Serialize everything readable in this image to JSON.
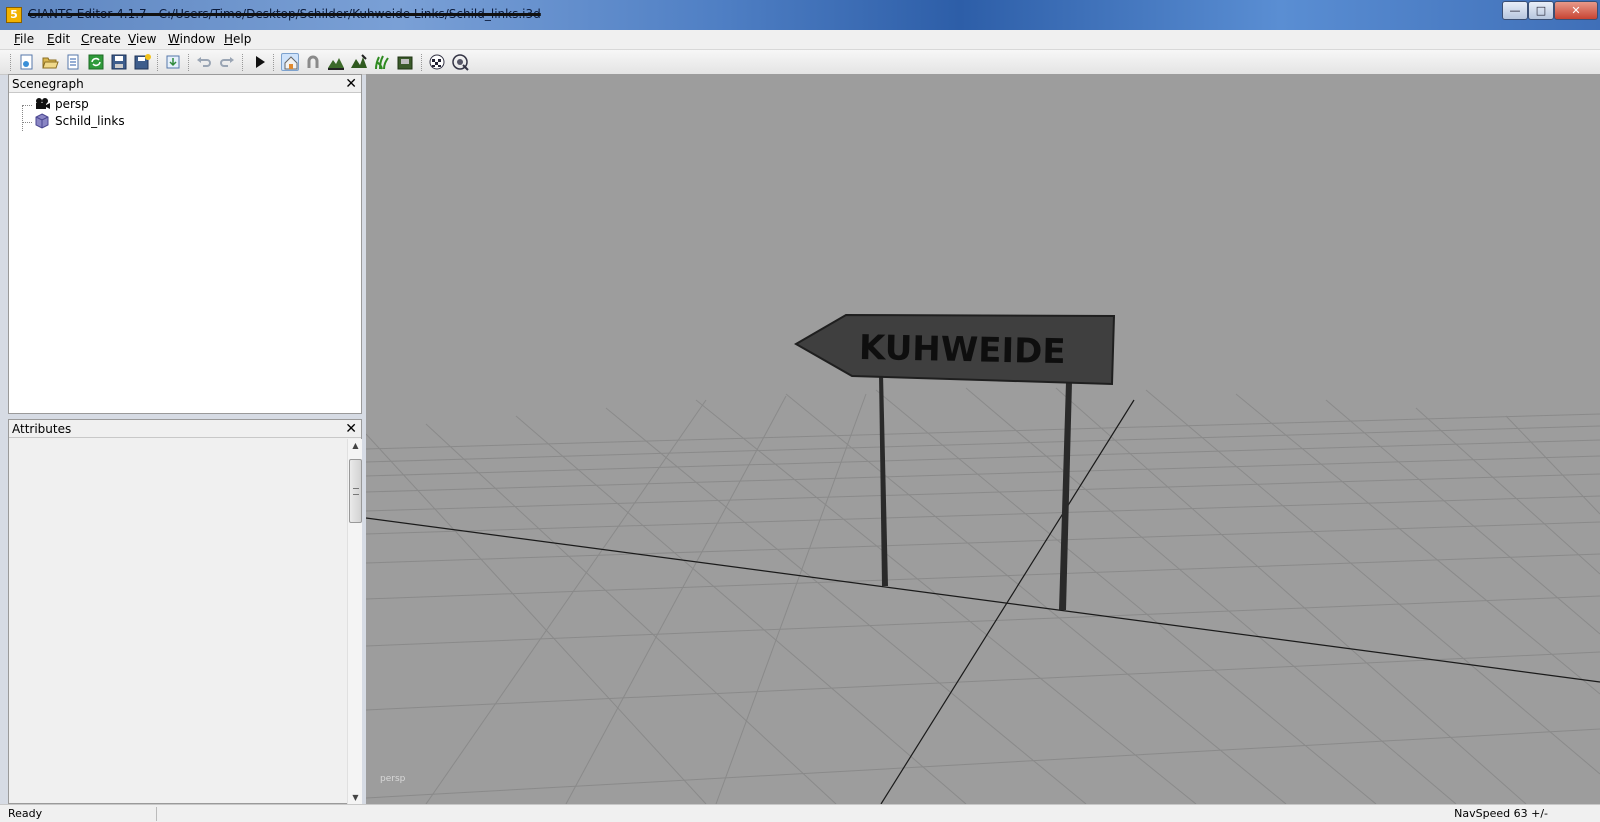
{
  "window": {
    "title": "GIANTS Editor 4.1.7 - C:/Users/Timo/Desktop/Schilder/Kuhweide Links/Schild_links.i3d",
    "app_icon": "5",
    "buttons": {
      "minimize_icon": "minimize-icon",
      "maximize_icon": "maximize-icon",
      "close_icon": "close-icon"
    }
  },
  "menu": {
    "items": [
      {
        "key": "F",
        "rest": "ile"
      },
      {
        "key": "E",
        "rest": "dit"
      },
      {
        "key": "C",
        "rest": "reate"
      },
      {
        "key": "V",
        "rest": "iew"
      },
      {
        "key": "W",
        "rest": "indow"
      },
      {
        "key": "H",
        "rest": "elp"
      }
    ]
  },
  "toolbar": {
    "icons": [
      "new-scene-icon",
      "open-icon",
      "list-icon",
      "refresh-icon",
      "save-icon",
      "save-as-icon",
      "import-icon",
      "undo-icon",
      "redo-icon",
      "play-icon",
      "select-icon",
      "magnet-icon",
      "terrain-icon",
      "paint-icon",
      "foliage-icon",
      "texture-icon",
      "checker-icon",
      "target-icon"
    ]
  },
  "scenegraph": {
    "title": "Scenegraph",
    "close": "✕",
    "nodes": [
      {
        "label": "persp",
        "icon": "camera-icon"
      },
      {
        "label": "Schild_links",
        "icon": "cube-icon"
      }
    ]
  },
  "attributes": {
    "title": "Attributes",
    "close": "✕"
  },
  "viewport": {
    "camera_label": "persp",
    "sign_text": "KUHWEIDE",
    "background": "#9d9d9d",
    "sign_color": "#3f3f3f"
  },
  "status": {
    "text": "Ready",
    "nav_speed": "NavSpeed 63 +/-"
  }
}
